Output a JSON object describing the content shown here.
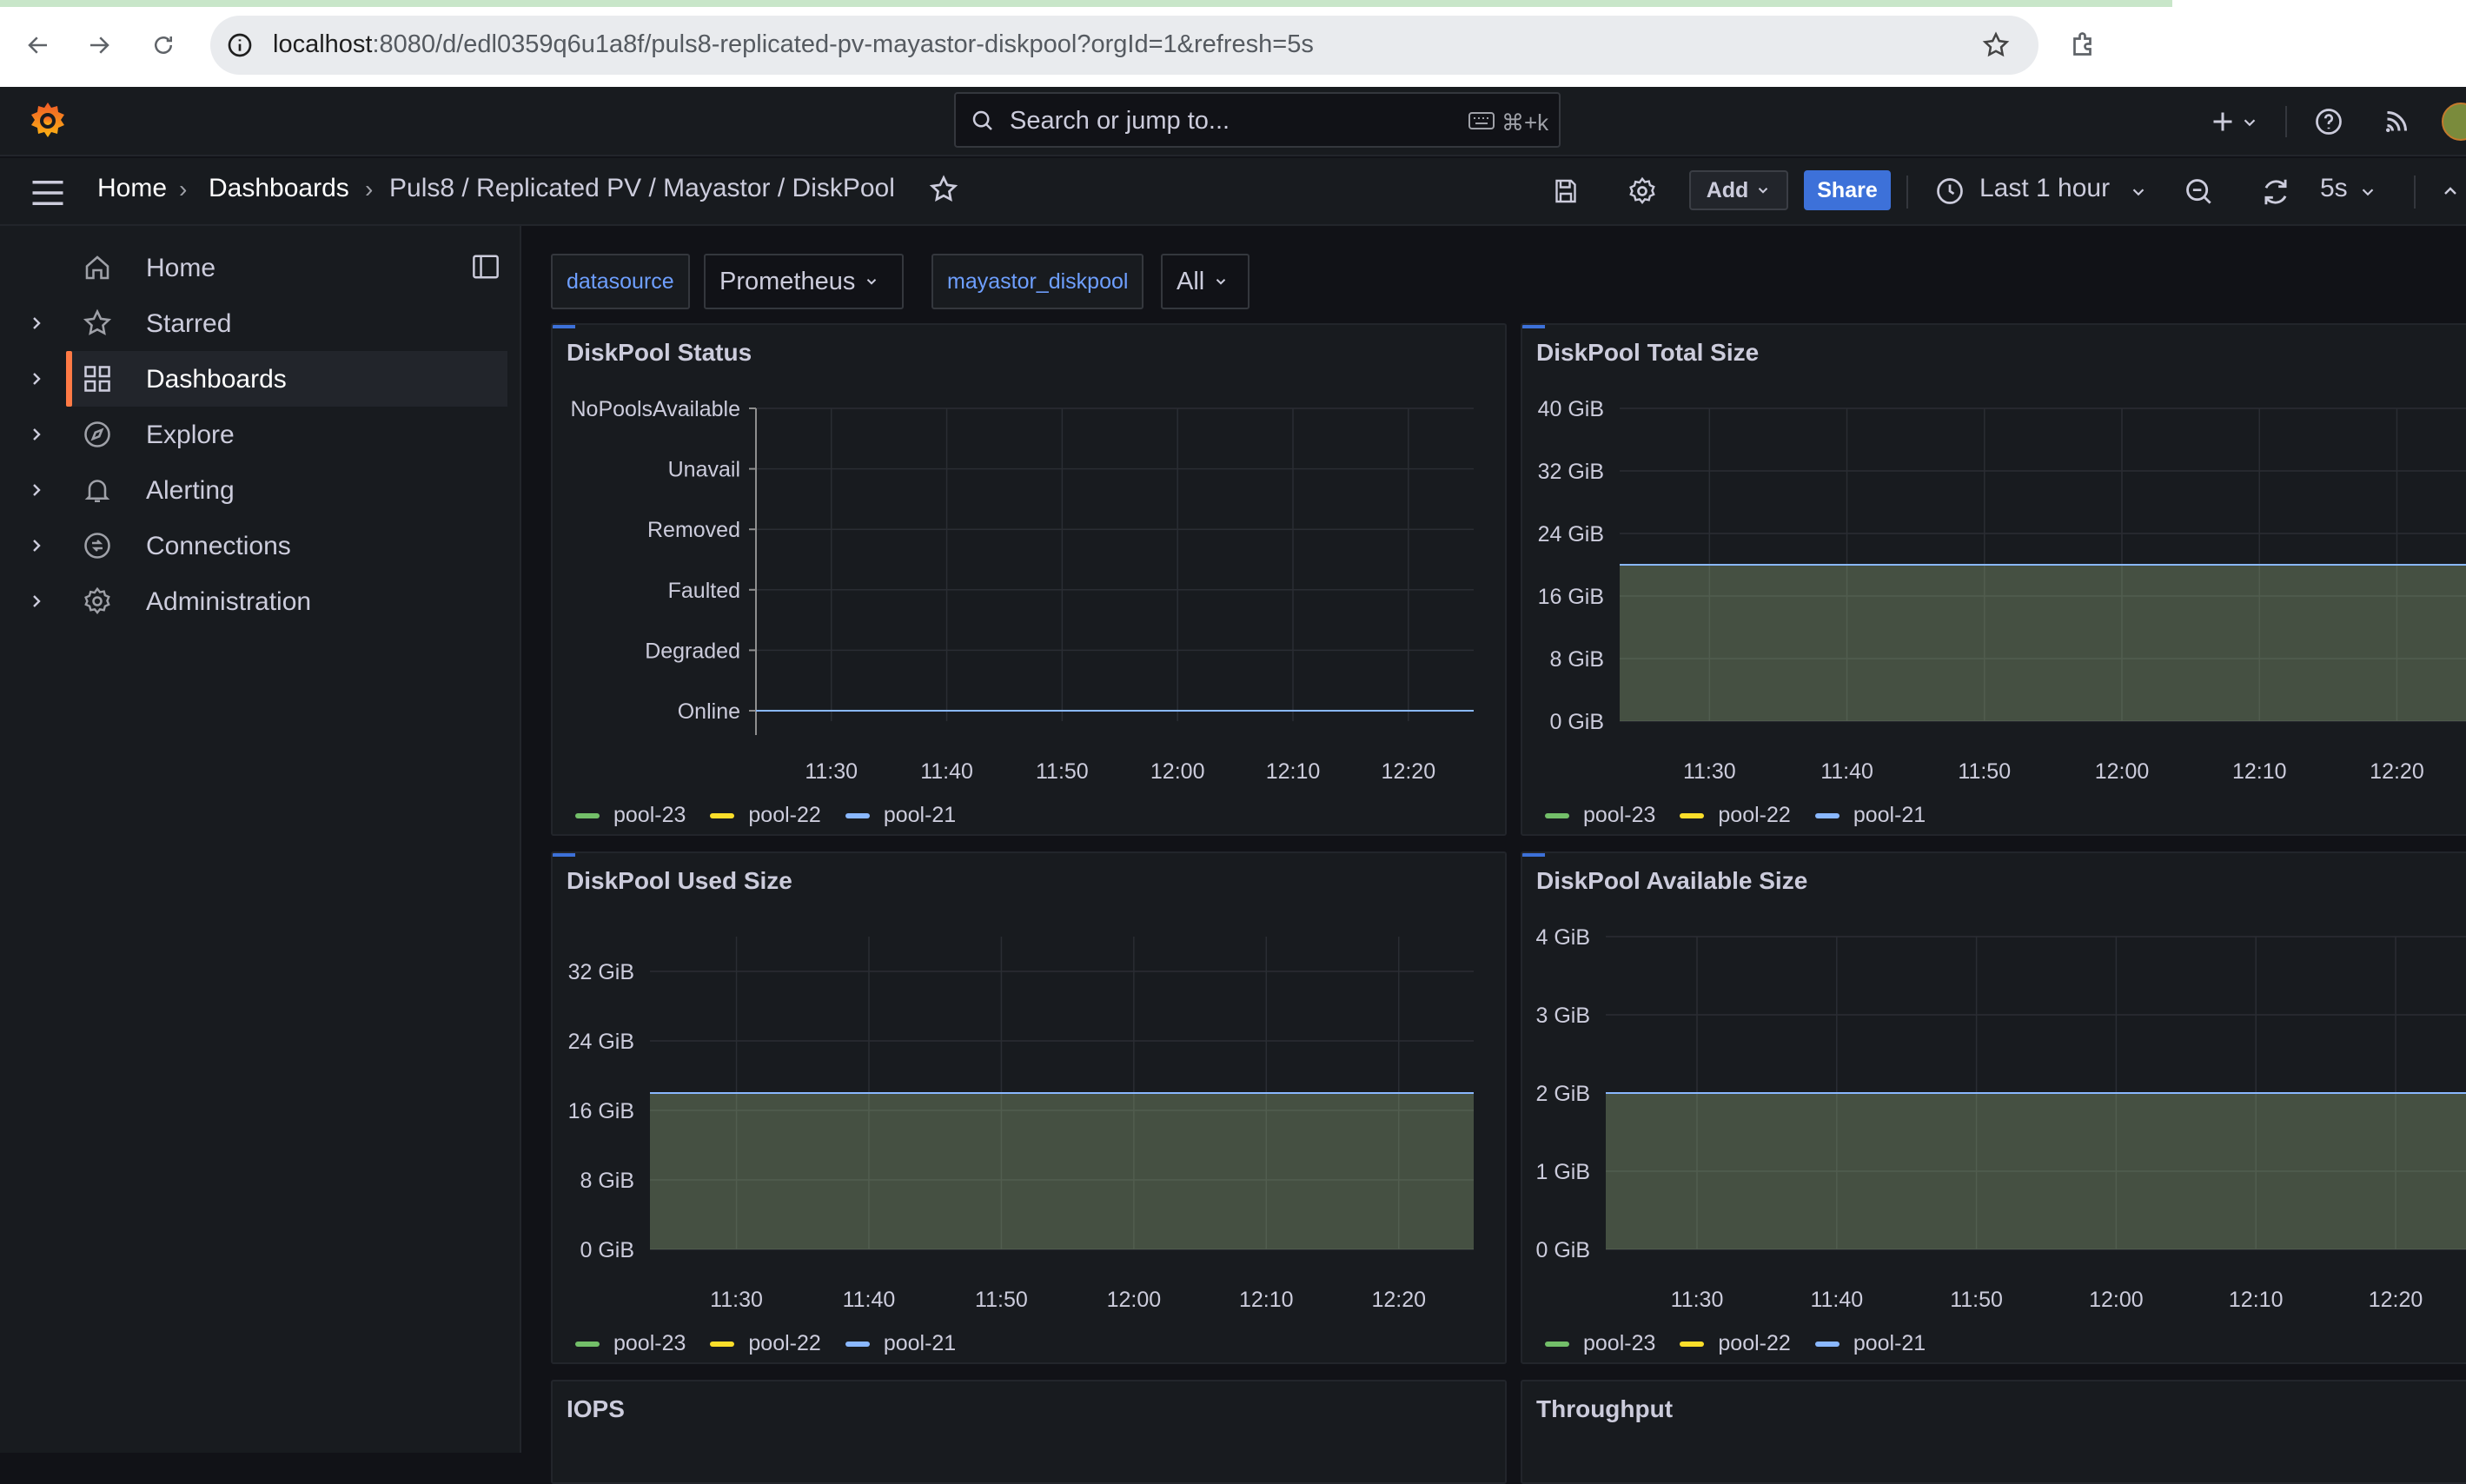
{
  "browser": {
    "url_host": "localhost",
    "url_rest": ":8080/d/edl0359q6u1a8f/puls8-replicated-pv-mayastor-diskpool?orgId=1&refresh=5s"
  },
  "topbar": {
    "search_placeholder": "Search or jump to...",
    "search_shortcut": "⌘+k"
  },
  "breadcrumb": {
    "home": "Home",
    "dashboards": "Dashboards",
    "current": "Puls8 / Replicated PV / Mayastor / DiskPool"
  },
  "toolbar": {
    "add_label": "Add",
    "share_label": "Share",
    "time_range": "Last 1 hour",
    "refresh_interval": "5s"
  },
  "sidebar": {
    "items": [
      {
        "label": "Home",
        "icon": "home-icon"
      },
      {
        "label": "Starred",
        "icon": "star-icon"
      },
      {
        "label": "Dashboards",
        "icon": "apps-icon"
      },
      {
        "label": "Explore",
        "icon": "compass-icon"
      },
      {
        "label": "Alerting",
        "icon": "bell-icon"
      },
      {
        "label": "Connections",
        "icon": "connections-icon"
      },
      {
        "label": "Administration",
        "icon": "cog-icon"
      }
    ]
  },
  "variables": {
    "datasource_label": "datasource",
    "datasource_value": "Prometheus",
    "pool_label": "mayastor_diskpool",
    "pool_value": "All"
  },
  "colors": {
    "pool-23": "#73bf69",
    "pool-22": "#fade2a",
    "pool-21": "#8ab8ff",
    "accent": "#ff7a45",
    "share": "#3d71d9"
  },
  "panels": {
    "status": {
      "title": "DiskPool Status"
    },
    "total": {
      "title": "DiskPool Total Size"
    },
    "used": {
      "title": "DiskPool Used Size"
    },
    "available": {
      "title": "DiskPool Available Size"
    },
    "iops": {
      "title": "IOPS"
    },
    "throughput": {
      "title": "Throughput"
    }
  },
  "chart_data": [
    {
      "id": "status",
      "type": "line",
      "title": "DiskPool Status",
      "x_ticks": [
        "11:30",
        "11:40",
        "11:50",
        "12:00",
        "12:10",
        "12:20"
      ],
      "y_categories": [
        "Online",
        "Degraded",
        "Faulted",
        "Removed",
        "Unavail",
        "NoPoolsAvailable"
      ],
      "series": [
        {
          "name": "pool-23",
          "value": "Online"
        },
        {
          "name": "pool-22",
          "value": "Online"
        },
        {
          "name": "pool-21",
          "value": "Online"
        }
      ],
      "legend": [
        "pool-23",
        "pool-22",
        "pool-21"
      ],
      "grid": true,
      "legend_placement": "bottom-left"
    },
    {
      "id": "total",
      "type": "area",
      "title": "DiskPool Total Size",
      "x_ticks": [
        "11:30",
        "11:40",
        "11:50",
        "12:00",
        "12:10",
        "12:20"
      ],
      "y_ticks": [
        "0 GiB",
        "8 GiB",
        "16 GiB",
        "24 GiB",
        "32 GiB",
        "40 GiB"
      ],
      "ylim": [
        0,
        40
      ],
      "unit": "GiB",
      "series": [
        {
          "name": "pool-23",
          "value": 20
        },
        {
          "name": "pool-22",
          "value": 20
        },
        {
          "name": "pool-21",
          "value": 20
        }
      ],
      "legend": [
        "pool-23",
        "pool-22",
        "pool-21"
      ],
      "grid": true,
      "legend_placement": "bottom-left"
    },
    {
      "id": "used",
      "type": "area",
      "title": "DiskPool Used Size",
      "x_ticks": [
        "11:30",
        "11:40",
        "11:50",
        "12:00",
        "12:10",
        "12:20"
      ],
      "y_ticks": [
        "0 GiB",
        "8 GiB",
        "16 GiB",
        "24 GiB",
        "32 GiB"
      ],
      "ylim": [
        0,
        36
      ],
      "unit": "GiB",
      "series": [
        {
          "name": "pool-23",
          "value": 18
        },
        {
          "name": "pool-22",
          "value": 18
        },
        {
          "name": "pool-21",
          "value": 18
        }
      ],
      "legend": [
        "pool-23",
        "pool-22",
        "pool-21"
      ],
      "grid": true,
      "legend_placement": "bottom-left"
    },
    {
      "id": "available",
      "type": "area",
      "title": "DiskPool Available Size",
      "x_ticks": [
        "11:30",
        "11:40",
        "11:50",
        "12:00",
        "12:10",
        "12:20"
      ],
      "y_ticks": [
        "0 GiB",
        "1 GiB",
        "2 GiB",
        "3 GiB",
        "4 GiB"
      ],
      "ylim": [
        0,
        4
      ],
      "unit": "GiB",
      "series": [
        {
          "name": "pool-23",
          "value": 2
        },
        {
          "name": "pool-22",
          "value": 2
        },
        {
          "name": "pool-21",
          "value": 2
        }
      ],
      "legend": [
        "pool-23",
        "pool-22",
        "pool-21"
      ],
      "grid": true,
      "legend_placement": "bottom-left"
    }
  ]
}
